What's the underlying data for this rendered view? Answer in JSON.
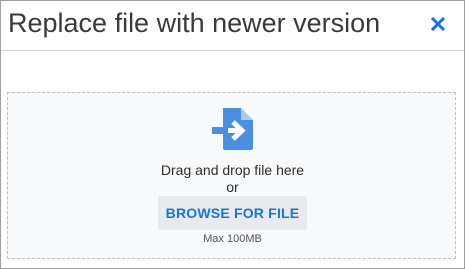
{
  "dialog": {
    "title": "Replace file with newer version",
    "close_icon": "close-icon"
  },
  "dropzone": {
    "icon": "file-upload-icon",
    "instruction": "Drag and drop file here",
    "or_text": "or",
    "browse_label": "BROWSE FOR FILE",
    "max_size": "Max 100MB"
  },
  "colors": {
    "accent": "#1a73d9",
    "icon": "#4a90e2",
    "dropzone_bg": "#f7f9fb",
    "dropzone_border": "#b9c2cc",
    "button_bg": "#e8eaed"
  }
}
